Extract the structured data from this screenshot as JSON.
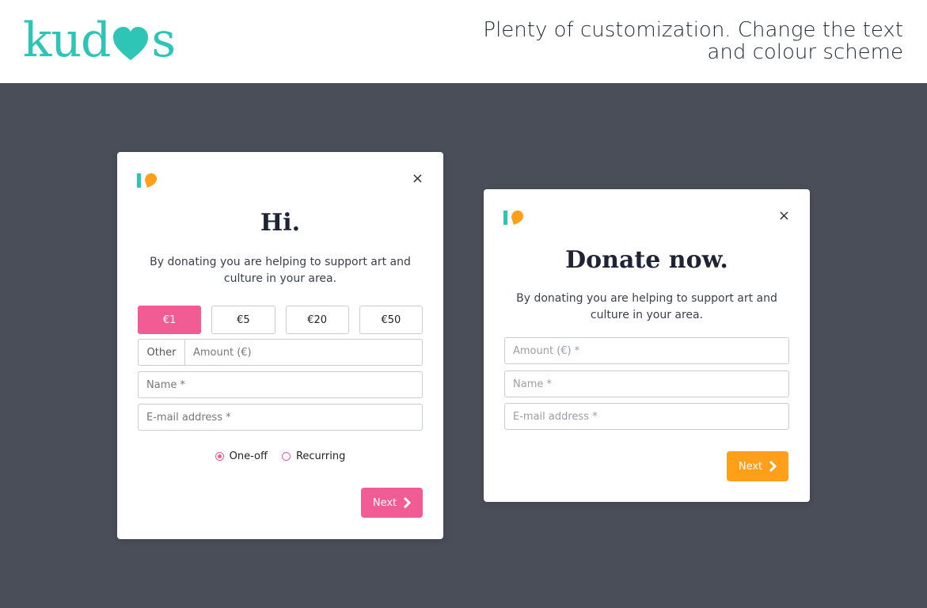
{
  "header": {
    "brand": {
      "text_left": "kud",
      "text_right": "s",
      "color": "#2ec4b6"
    },
    "tagline": "Plenty of customization. Change the text and colour scheme"
  },
  "colors": {
    "pink": "#f25c94",
    "orange": "#ff9f1a",
    "teal": "#2ec4b6",
    "background": "#4a4e59"
  },
  "card1": {
    "close": "×",
    "title": "Hi.",
    "description": "By donating you are helping to support art and culture in your area.",
    "amounts": [
      "€1",
      "€5",
      "€20",
      "€50"
    ],
    "selected_amount": "€1",
    "other_label": "Other",
    "amount_placeholder": "Amount (€)",
    "name_placeholder": "Name *",
    "email_placeholder": "E-mail address *",
    "frequency": {
      "one_off": "One-off",
      "recurring": "Recurring",
      "selected": "One-off"
    },
    "next": "Next"
  },
  "card2": {
    "close": "×",
    "title": "Donate now.",
    "description": "By donating you are helping to support art and culture in your area.",
    "amount_placeholder": "Amount (€) *",
    "name_placeholder": "Name *",
    "email_placeholder": "E-mail address *",
    "next": "Next"
  }
}
